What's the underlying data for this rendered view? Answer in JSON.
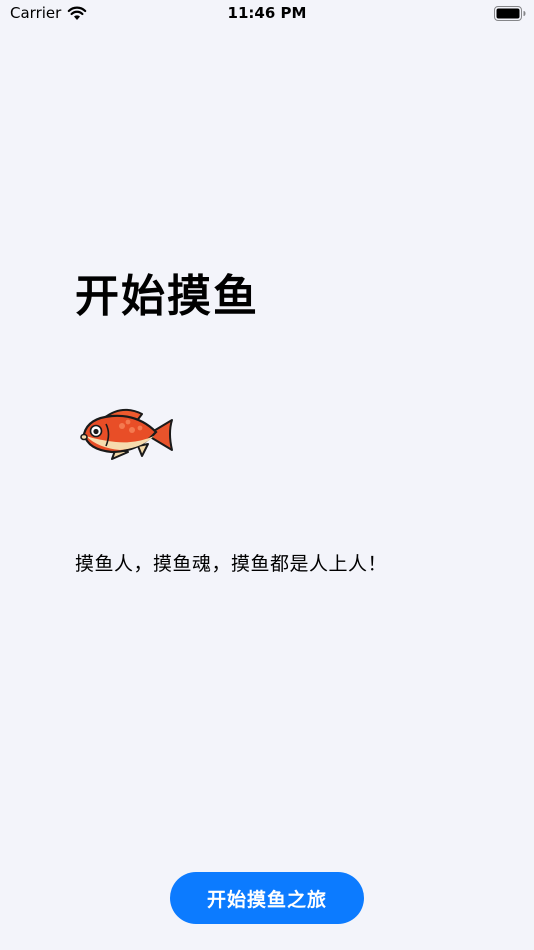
{
  "status_bar": {
    "carrier": "Carrier",
    "time": "11:46 PM"
  },
  "main": {
    "title": "开始摸鱼",
    "slogan": "摸鱼人，摸鱼魂，摸鱼都是人上人！",
    "start_button_label": "开始摸鱼之旅"
  },
  "icons": {
    "fish": "fish-icon",
    "wifi": "wifi-icon",
    "battery": "battery-icon"
  },
  "colors": {
    "background": "#f3f4fa",
    "accent": "#0c7bff"
  }
}
